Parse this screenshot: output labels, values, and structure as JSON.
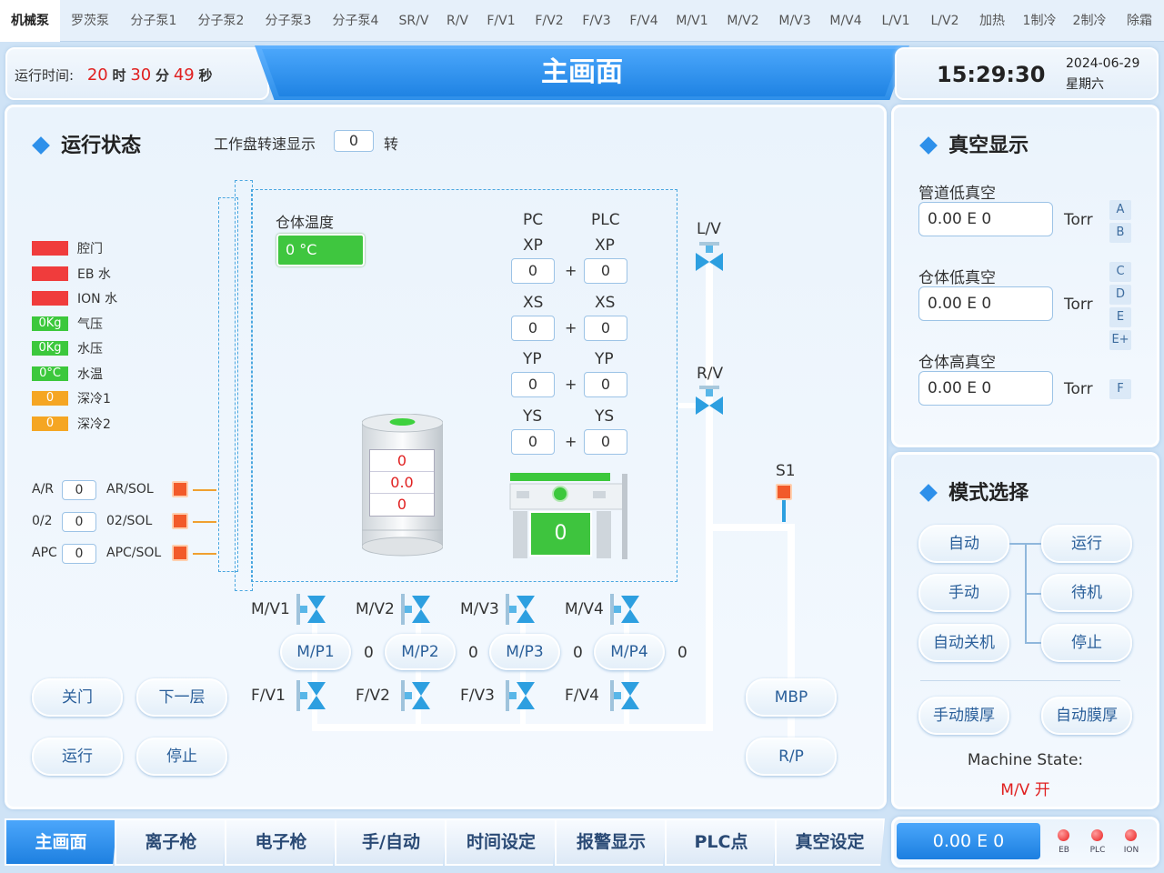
{
  "top_tabs": [
    "机械泵",
    "罗茨泵",
    "分子泵1",
    "分子泵2",
    "分子泵3",
    "分子泵4",
    "SR/V",
    "R/V",
    "F/V1",
    "F/V2",
    "F/V3",
    "F/V4",
    "M/V1",
    "M/V2",
    "M/V3",
    "M/V4",
    "L/V1",
    "L/V2",
    "加热",
    "1制冷",
    "2制冷",
    "除霜"
  ],
  "header": {
    "runtime_label": "运行时间:",
    "hours": "20",
    "h_unit": "时",
    "minutes": "30",
    "m_unit": "分",
    "seconds": "49",
    "s_unit": "秒",
    "title": "主画面",
    "time": "15:29:30",
    "date": "2024-06-29",
    "weekday": "星期六"
  },
  "run_status": {
    "title": "运行状态",
    "speed_label": "工作盘转速显示",
    "speed_value": "0",
    "speed_unit": "转",
    "indicators": [
      {
        "value": "",
        "label": "腔门",
        "color": "#f03c3c"
      },
      {
        "value": "",
        "label": "EB 水",
        "color": "#f03c3c"
      },
      {
        "value": "",
        "label": "ION 水",
        "color": "#f03c3c"
      },
      {
        "value": "0Kg",
        "label": "气压",
        "color": "#3cc83c"
      },
      {
        "value": "0Kg",
        "label": "水压",
        "color": "#3cc83c"
      },
      {
        "value": "0°C",
        "label": "水温",
        "color": "#3cc83c"
      },
      {
        "value": "0",
        "label": "深冷1",
        "color": "#f5a623"
      },
      {
        "value": "0",
        "label": "深冷2",
        "color": "#f5a623"
      }
    ],
    "gas": [
      {
        "label": "A/R",
        "value": "0",
        "sol": "AR/SOL"
      },
      {
        "label": "0/2",
        "value": "0",
        "sol": "02/SOL"
      },
      {
        "label": "APC",
        "value": "0",
        "sol": "APC/SOL"
      }
    ],
    "chamber_temp_label": "仓体温度",
    "chamber_temp": "0 °C",
    "pc_label": "PC",
    "plc_label": "PLC",
    "axes": [
      {
        "name": "XP",
        "pc": "0",
        "plc": "0"
      },
      {
        "name": "XS",
        "pc": "0",
        "plc": "0"
      },
      {
        "name": "YP",
        "pc": "0",
        "plc": "0"
      },
      {
        "name": "YS",
        "pc": "0",
        "plc": "0"
      }
    ],
    "plus": "+",
    "crucible": [
      "0",
      "0.0",
      "0"
    ],
    "stage_value": "0",
    "valves": {
      "lv": "L/V",
      "rv": "R/V",
      "s1": "S1",
      "mv": [
        "M/V1",
        "M/V2",
        "M/V3",
        "M/V4"
      ],
      "fv": [
        "F/V1",
        "F/V2",
        "F/V3",
        "F/V4"
      ]
    },
    "mp": [
      {
        "label": "M/P1",
        "value": "0"
      },
      {
        "label": "M/P2",
        "value": "0"
      },
      {
        "label": "M/P3",
        "value": "0"
      },
      {
        "label": "M/P4",
        "value": "0"
      }
    ],
    "mbp": "MBP",
    "rp": "R/P",
    "buttons": {
      "close_door": "关门",
      "next_layer": "下一层",
      "run": "运行",
      "stop": "停止"
    }
  },
  "vacuum": {
    "title": "真空显示",
    "items": [
      {
        "label": "管道低真空",
        "value": "0.00 E 0",
        "unit": "Torr"
      },
      {
        "label": "仓体低真空",
        "value": "0.00 E 0",
        "unit": "Torr"
      },
      {
        "label": "仓体高真空",
        "value": "0.00 E 0",
        "unit": "Torr"
      }
    ],
    "side_buttons": [
      "A",
      "B",
      "C",
      "D",
      "E",
      "E+",
      "F"
    ]
  },
  "mode": {
    "title": "模式选择",
    "auto": "自动",
    "manual": "手动",
    "auto_off": "自动关机",
    "run": "运行",
    "standby": "待机",
    "stop": "停止",
    "manual_film": "手动膜厚",
    "auto_film": "自动膜厚",
    "state_label": "Machine State:",
    "state_value": "M/V 开"
  },
  "bottom_tabs": [
    "主画面",
    "离子枪",
    "电子枪",
    "手/自动",
    "时间设定",
    "报警显示",
    "PLC点",
    "真空设定"
  ],
  "bottom_readout": "0.00 E 0",
  "leds": [
    "EB",
    "PLC",
    "ION"
  ]
}
